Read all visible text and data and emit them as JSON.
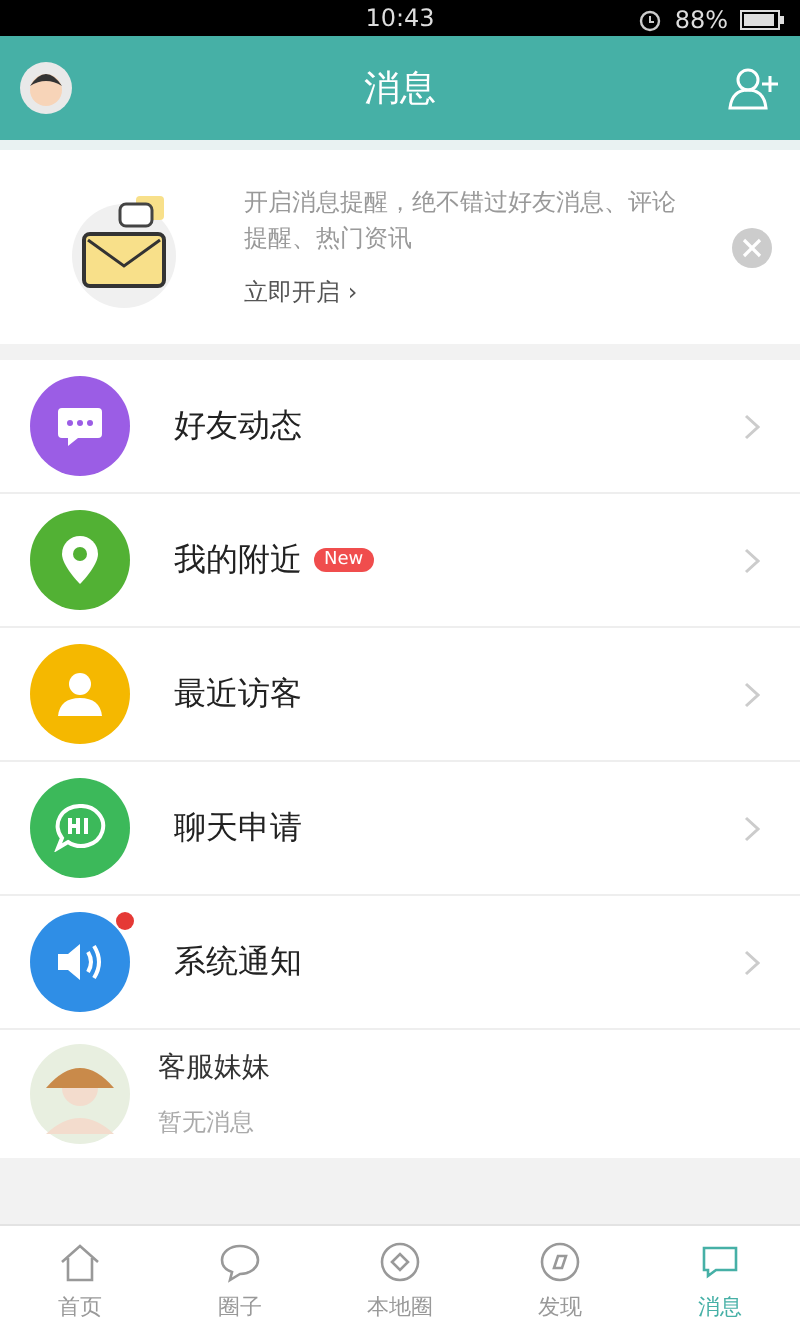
{
  "status_bar": {
    "time": "10:43",
    "battery": "88%"
  },
  "header": {
    "title": "消息"
  },
  "banner": {
    "text": "开启消息提醒，绝不错过好友消息、评论提醒、热门资讯",
    "link": "立即开启 ›"
  },
  "items": [
    {
      "label": "好友动态",
      "kind": "chat",
      "color": "#9b5de5",
      "dot": false
    },
    {
      "label": "我的附近",
      "kind": "location",
      "color": "#52b134",
      "badge": "New",
      "dot": false
    },
    {
      "label": "最近访客",
      "kind": "person",
      "color": "#f5b800",
      "dot": false
    },
    {
      "label": "聊天申请",
      "kind": "hi",
      "color": "#3cb95a",
      "dot": false
    },
    {
      "label": "系统通知",
      "kind": "speaker",
      "color": "#2f8ee6",
      "dot": true
    }
  ],
  "contact": {
    "name": "客服妹妹",
    "preview": "暂无消息"
  },
  "tabs": [
    {
      "label": "首页",
      "kind": "home",
      "selected": false
    },
    {
      "label": "圈子",
      "kind": "chat",
      "selected": false
    },
    {
      "label": "本地圈",
      "kind": "local",
      "selected": false
    },
    {
      "label": "发现",
      "kind": "discover",
      "selected": false
    },
    {
      "label": "消息",
      "kind": "message",
      "selected": true
    }
  ]
}
